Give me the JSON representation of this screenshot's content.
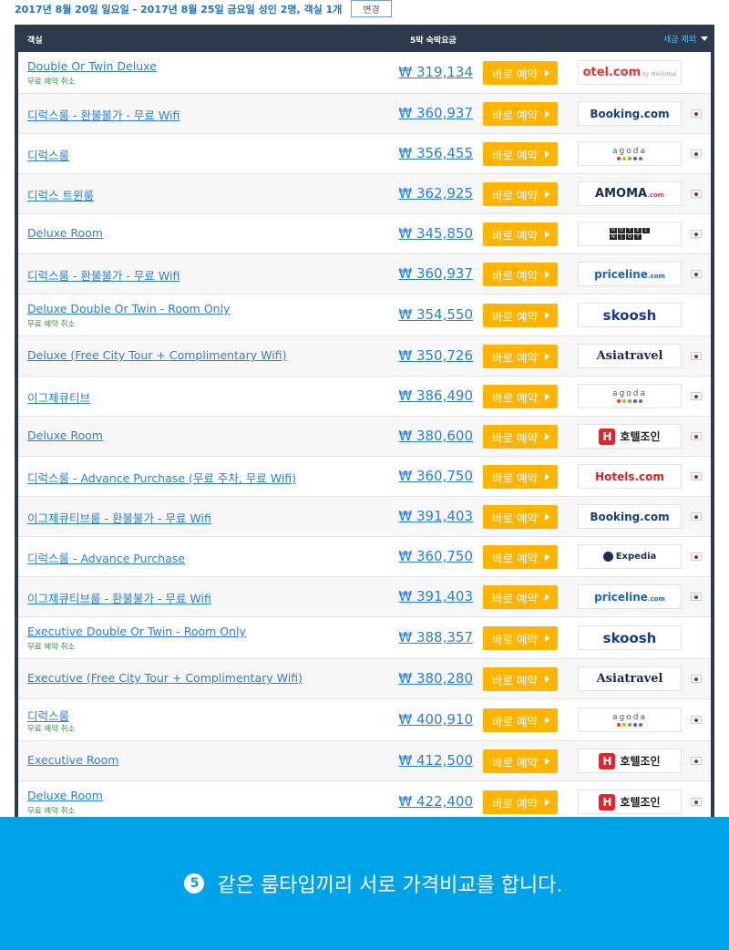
{
  "search": {
    "summary": "2017년 8월 20일 일요일 - 2017년 8월 25일 금요일 성인 2명, 객실 1개",
    "change_label": "변경"
  },
  "table": {
    "col_room": "객실",
    "col_price": "5박 숙박요금",
    "col_tax": "세금 제외",
    "book_label": "바로 예약",
    "free_cancel": "무료 예약 취소"
  },
  "rows": [
    {
      "room": "Double Or Twin Deluxe",
      "free_cancel": true,
      "price": "₩ 319,134",
      "provider": "otel",
      "flag": false
    },
    {
      "room": "디럭스룸 - 환불불가 - 무료 Wifi",
      "free_cancel": false,
      "price": "₩ 360,937",
      "provider": "booking",
      "flag": true
    },
    {
      "room": "디럭스룸",
      "free_cancel": false,
      "price": "₩ 356,455",
      "provider": "agoda",
      "flag": true
    },
    {
      "room": "디럭스 트윈룸",
      "free_cancel": false,
      "price": "₩ 362,925",
      "provider": "amoma",
      "flag": true
    },
    {
      "room": "Deluxe Room",
      "free_cancel": false,
      "price": "₩ 345,850",
      "provider": "hotelnjoy",
      "flag": true
    },
    {
      "room": "디럭스룸 - 환불불가 - 무료 Wifi",
      "free_cancel": false,
      "price": "₩ 360,937",
      "provider": "priceline",
      "flag": true
    },
    {
      "room": "Deluxe Double Or Twin - Room Only",
      "free_cancel": true,
      "price": "₩ 354,550",
      "provider": "skoosh",
      "flag": false
    },
    {
      "room": "Deluxe (Free City Tour + Complimentary Wifi)",
      "free_cancel": false,
      "price": "₩ 350,726",
      "provider": "asiatravel",
      "flag": true
    },
    {
      "room": "이그제큐티브",
      "free_cancel": false,
      "price": "₩ 386,490",
      "provider": "agoda",
      "flag": true
    },
    {
      "room": "Deluxe Room",
      "free_cancel": false,
      "price": "₩ 380,600",
      "provider": "hoteljoin",
      "flag": true
    },
    {
      "room": "디럭스룸 - Advance Purchase (무료 주차, 무료 Wifi)",
      "free_cancel": false,
      "price": "₩ 360,750",
      "provider": "hotels",
      "flag": true
    },
    {
      "room": "이그제큐티브룸 - 환불불가 - 무료 Wifi",
      "free_cancel": false,
      "price": "₩ 391,403",
      "provider": "booking",
      "flag": true
    },
    {
      "room": "디럭스룸 - Advance Purchase",
      "free_cancel": false,
      "price": "₩ 360,750",
      "provider": "expedia",
      "flag": true
    },
    {
      "room": "이그제큐티브룸 - 환불불가 - 무료 Wifi",
      "free_cancel": false,
      "price": "₩ 391,403",
      "provider": "priceline",
      "flag": true
    },
    {
      "room": "Executive Double Or Twin - Room Only",
      "free_cancel": true,
      "price": "₩ 388,357",
      "provider": "skoosh",
      "flag": false
    },
    {
      "room": "Executive (Free City Tour + Complimentary Wifi)",
      "free_cancel": false,
      "price": "₩ 380,280",
      "provider": "asiatravel",
      "flag": true
    },
    {
      "room": "디럭스룸",
      "free_cancel": true,
      "price": "₩ 400,910",
      "provider": "agoda",
      "flag": true
    },
    {
      "room": "Executive Room",
      "free_cancel": false,
      "price": "₩ 412,500",
      "provider": "hoteljoin",
      "flag": true
    },
    {
      "room": "Deluxe Room",
      "free_cancel": true,
      "price": "₩ 422,400",
      "provider": "hoteljoin",
      "flag": true
    }
  ],
  "providers": {
    "otel": {
      "name": "otel.com",
      "sub": "by MeGlobal"
    },
    "booking": {
      "name": "Booking.com"
    },
    "agoda": {
      "name": "agoda"
    },
    "amoma": {
      "name": "AMOMA",
      "sub": ".com"
    },
    "hotelnjoy": {
      "name": "HOTELNJOY"
    },
    "priceline": {
      "name": "priceline",
      "sub": ".com"
    },
    "skoosh": {
      "name": "skoosh"
    },
    "asiatravel": {
      "name": "Asiatravel"
    },
    "hoteljoin": {
      "name": "호텔조인",
      "mark": "H"
    },
    "hotels": {
      "name": "Hotels.com"
    },
    "expedia": {
      "name": "Expedia"
    }
  },
  "colors": {
    "header_bg": "#2d3a4e",
    "link": "#2a7fd4",
    "book_button": "#ffb400",
    "free_cancel": "#1e9e3c",
    "banner_bg": "#00a3e8"
  },
  "banner": {
    "number": "5",
    "text": "같은 룸타입끼리 서로 가격비교를 합니다."
  }
}
